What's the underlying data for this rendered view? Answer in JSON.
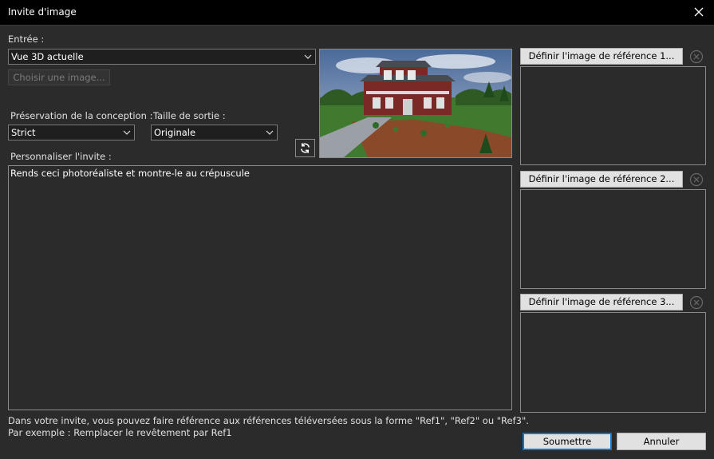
{
  "window": {
    "title": "Invite d'image"
  },
  "input": {
    "label": "Entrée :",
    "value": "Vue 3D actuelle",
    "choose_label": "Choisir une image..."
  },
  "preservation": {
    "label": "Préservation de la conception :",
    "value": "Strict"
  },
  "output_size": {
    "label": "Taille de sortie :",
    "value": "Originale"
  },
  "prompt": {
    "label": "Personnaliser l'invite :",
    "value": "Rends ceci photoréaliste et montre-le au crépuscule"
  },
  "references": [
    {
      "label": "Définir l'image de référence 1..."
    },
    {
      "label": "Définir l'image de référence 2..."
    },
    {
      "label": "Définir l'image de référence 3..."
    }
  ],
  "help": {
    "line1": "Dans votre invite, vous pouvez faire référence aux références téléversées sous la forme \"Ref1\", \"Ref2\" ou \"Ref3\".",
    "line2": "Par exemple : Remplacer le revêtement par Ref1"
  },
  "actions": {
    "submit_label": "Soumettre",
    "cancel_label": "Annuler"
  },
  "icons": {
    "close": "close-icon",
    "chevron": "chevron-down-icon",
    "refresh": "refresh-icon",
    "clear": "clear-circle-icon"
  },
  "colors": {
    "accent": "#0078d7",
    "background": "#2b2b2b",
    "titlebar": "#000000"
  }
}
